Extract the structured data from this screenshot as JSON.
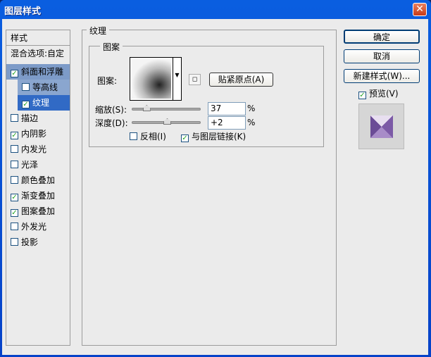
{
  "window": {
    "title": "图层样式",
    "close": "✕"
  },
  "sidebar": {
    "header": "样式",
    "blend": "混合选项:自定",
    "items": [
      {
        "label": "斜面和浮雕",
        "checked": true
      },
      {
        "label": "等高线",
        "checked": false
      },
      {
        "label": "纹理",
        "checked": true
      },
      {
        "label": "描边",
        "checked": false
      },
      {
        "label": "内阴影",
        "checked": true
      },
      {
        "label": "内发光",
        "checked": false
      },
      {
        "label": "光泽",
        "checked": false
      },
      {
        "label": "颜色叠加",
        "checked": false
      },
      {
        "label": "渐变叠加",
        "checked": true
      },
      {
        "label": "图案叠加",
        "checked": true
      },
      {
        "label": "外发光",
        "checked": false
      },
      {
        "label": "投影",
        "checked": false
      }
    ]
  },
  "texture": {
    "title": "纹理",
    "group": "图案",
    "pattern_label": "图案:",
    "snap_button": "贴紧原点(A)",
    "scale_label": "缩放(S):",
    "scale_value": "37",
    "scale_unit": "%",
    "scale_pct": 37,
    "depth_label": "深度(D):",
    "depth_value": "+2",
    "depth_unit": "%",
    "invert_label": "反相(I)",
    "invert_checked": false,
    "link_label": "与图层链接(K)",
    "link_checked": true
  },
  "buttons": {
    "ok": "确定",
    "cancel": "取消",
    "new_style": "新建样式(W)...",
    "preview": "预览(V)",
    "preview_checked": true
  }
}
